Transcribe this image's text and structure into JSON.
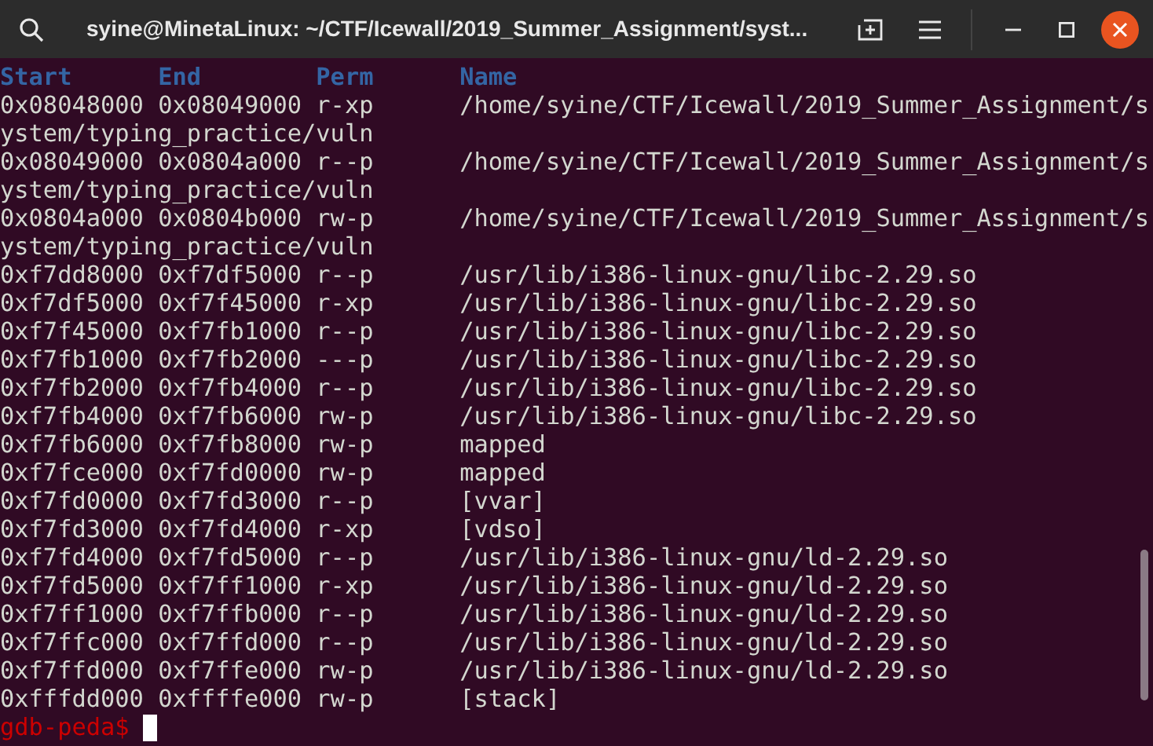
{
  "window": {
    "title": "syine@MinetaLinux: ~/CTF/Icewall/2019_Summer_Assignment/syst..."
  },
  "table": {
    "columns": [
      "Start",
      "End",
      "Perm",
      "Name"
    ],
    "rows": [
      {
        "start": "0x08048000",
        "end": "0x08049000",
        "perm": "r-xp",
        "name": "/home/syine/CTF/Icewall/2019_Summer_Assignment/system/typing_practice/vuln"
      },
      {
        "start": "0x08049000",
        "end": "0x0804a000",
        "perm": "r--p",
        "name": "/home/syine/CTF/Icewall/2019_Summer_Assignment/system/typing_practice/vuln"
      },
      {
        "start": "0x0804a000",
        "end": "0x0804b000",
        "perm": "rw-p",
        "name": "/home/syine/CTF/Icewall/2019_Summer_Assignment/system/typing_practice/vuln"
      },
      {
        "start": "0xf7dd8000",
        "end": "0xf7df5000",
        "perm": "r--p",
        "name": "/usr/lib/i386-linux-gnu/libc-2.29.so"
      },
      {
        "start": "0xf7df5000",
        "end": "0xf7f45000",
        "perm": "r-xp",
        "name": "/usr/lib/i386-linux-gnu/libc-2.29.so"
      },
      {
        "start": "0xf7f45000",
        "end": "0xf7fb1000",
        "perm": "r--p",
        "name": "/usr/lib/i386-linux-gnu/libc-2.29.so"
      },
      {
        "start": "0xf7fb1000",
        "end": "0xf7fb2000",
        "perm": "---p",
        "name": "/usr/lib/i386-linux-gnu/libc-2.29.so"
      },
      {
        "start": "0xf7fb2000",
        "end": "0xf7fb4000",
        "perm": "r--p",
        "name": "/usr/lib/i386-linux-gnu/libc-2.29.so"
      },
      {
        "start": "0xf7fb4000",
        "end": "0xf7fb6000",
        "perm": "rw-p",
        "name": "/usr/lib/i386-linux-gnu/libc-2.29.so"
      },
      {
        "start": "0xf7fb6000",
        "end": "0xf7fb8000",
        "perm": "rw-p",
        "name": "mapped"
      },
      {
        "start": "0xf7fce000",
        "end": "0xf7fd0000",
        "perm": "rw-p",
        "name": "mapped"
      },
      {
        "start": "0xf7fd0000",
        "end": "0xf7fd3000",
        "perm": "r--p",
        "name": "[vvar]"
      },
      {
        "start": "0xf7fd3000",
        "end": "0xf7fd4000",
        "perm": "r-xp",
        "name": "[vdso]"
      },
      {
        "start": "0xf7fd4000",
        "end": "0xf7fd5000",
        "perm": "r--p",
        "name": "/usr/lib/i386-linux-gnu/ld-2.29.so"
      },
      {
        "start": "0xf7fd5000",
        "end": "0xf7ff1000",
        "perm": "r-xp",
        "name": "/usr/lib/i386-linux-gnu/ld-2.29.so"
      },
      {
        "start": "0xf7ff1000",
        "end": "0xf7ffb000",
        "perm": "r--p",
        "name": "/usr/lib/i386-linux-gnu/ld-2.29.so"
      },
      {
        "start": "0xf7ffc000",
        "end": "0xf7ffd000",
        "perm": "r--p",
        "name": "/usr/lib/i386-linux-gnu/ld-2.29.so"
      },
      {
        "start": "0xf7ffd000",
        "end": "0xf7ffe000",
        "perm": "rw-p",
        "name": "/usr/lib/i386-linux-gnu/ld-2.29.so"
      },
      {
        "start": "0xfffdd000",
        "end": "0xffffe000",
        "perm": "rw-p",
        "name": "[stack]"
      }
    ]
  },
  "prompt": "gdb-peda$"
}
